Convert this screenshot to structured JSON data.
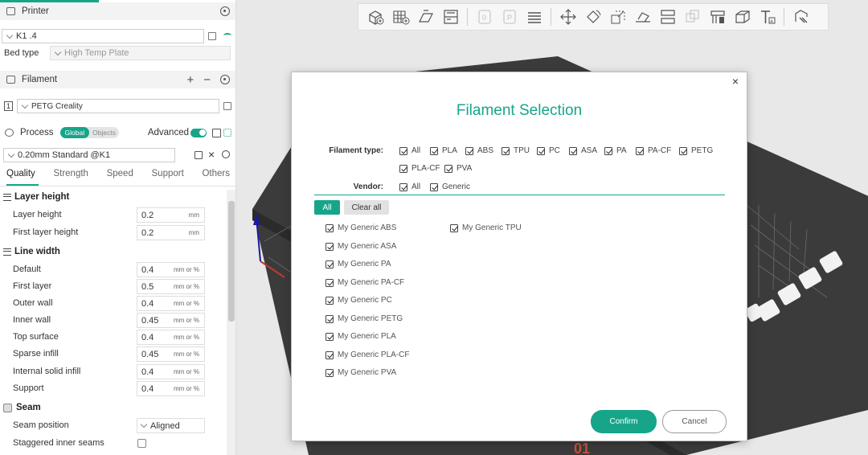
{
  "colors": {
    "accent": "#17a589",
    "plate": "#3b3b3b",
    "background": "#e8e8e8"
  },
  "sidebar": {
    "printer": {
      "title": "Printer",
      "name": "K1 .4",
      "bed_type_label": "Bed type",
      "bed_type_value": "High Temp Plate"
    },
    "filament": {
      "title": "Filament",
      "slot": "1",
      "name": "PETG Creality"
    },
    "process": {
      "title": "Process",
      "global_label": "Global",
      "objects_label": "Objects",
      "advanced_label": "Advanced",
      "preset": "0.20mm Standard @K1"
    },
    "tabs": [
      "Quality",
      "Strength",
      "Speed",
      "Support",
      "Others"
    ],
    "groups": {
      "layer_height": "Layer height",
      "line_width": "Line width",
      "seam": "Seam"
    },
    "params": {
      "layer_height": {
        "label": "Layer height",
        "value": "0.2",
        "unit": "mm"
      },
      "first_layer_height": {
        "label": "First layer height",
        "value": "0.2",
        "unit": "mm"
      },
      "default": {
        "label": "Default",
        "value": "0.4",
        "unit": "mm or %"
      },
      "first_layer": {
        "label": "First layer",
        "value": "0.5",
        "unit": "mm or %"
      },
      "outer_wall": {
        "label": "Outer wall",
        "value": "0.4",
        "unit": "mm or %"
      },
      "inner_wall": {
        "label": "Inner wall",
        "value": "0.45",
        "unit": "mm or %"
      },
      "top_surface": {
        "label": "Top surface",
        "value": "0.4",
        "unit": "mm or %"
      },
      "sparse_infill": {
        "label": "Sparse infill",
        "value": "0.45",
        "unit": "mm or %"
      },
      "internal_solid_infill": {
        "label": "Internal solid infill",
        "value": "0.4",
        "unit": "mm or %"
      },
      "support": {
        "label": "Support",
        "value": "0.4",
        "unit": "mm or %"
      },
      "seam_position": {
        "label": "Seam position",
        "value": "Aligned"
      },
      "staggered_inner_seams": {
        "label": "Staggered inner seams"
      }
    }
  },
  "toolbar": {
    "icons": [
      "add-object-icon",
      "arrange-grid-icon",
      "auto-orient-icon",
      "split-layout-icon",
      "plate-0-icon",
      "plate-p-icon",
      "layers-icon",
      "move-icon",
      "rotate-icon",
      "scale-icon",
      "lay-on-face-icon",
      "cut-icon",
      "boolean-icon",
      "support-paint-icon",
      "seam-paint-icon",
      "text-icon",
      "measure-icon"
    ]
  },
  "dialog": {
    "title": "Filament Selection",
    "filament_type_label": "Filament type:",
    "filament_types": [
      "All",
      "PLA",
      "ABS",
      "TPU",
      "PC",
      "ASA",
      "PA",
      "PA-CF",
      "PETG",
      "PLA-CF",
      "PVA"
    ],
    "vendor_label": "Vendor:",
    "vendors": [
      "All",
      "Generic"
    ],
    "all_button": "All",
    "clear_all_button": "Clear all",
    "filaments_col1": [
      "My Generic ABS",
      "My Generic ASA",
      "My Generic PA",
      "My Generic PA-CF",
      "My Generic PC",
      "My Generic PETG",
      "My Generic PLA",
      "My Generic PLA-CF",
      "My Generic PVA"
    ],
    "filaments_col2": [
      "My Generic TPU"
    ],
    "confirm": "Confirm",
    "cancel": "Cancel",
    "close": "×"
  },
  "viewport": {
    "plate_label": "01"
  }
}
